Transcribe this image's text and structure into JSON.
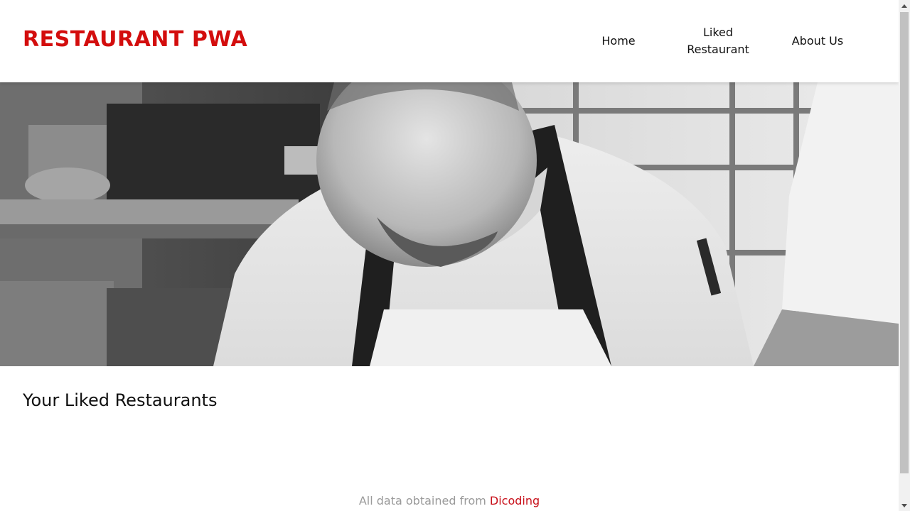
{
  "header": {
    "brand": "RESTAURANT PWA",
    "nav": [
      {
        "label": "Home"
      },
      {
        "label": "Liked Restaurant"
      },
      {
        "label": "About Us"
      }
    ]
  },
  "hero": {
    "image": "chef-in-kitchen-photo"
  },
  "main": {
    "title": "Your Liked Restaurants"
  },
  "footer": {
    "text": "All data obtained from ",
    "link_label": "Dicoding"
  },
  "colors": {
    "brand": "#d30d0d",
    "link": "#c8101a",
    "footer_text": "#9a9a9a"
  }
}
